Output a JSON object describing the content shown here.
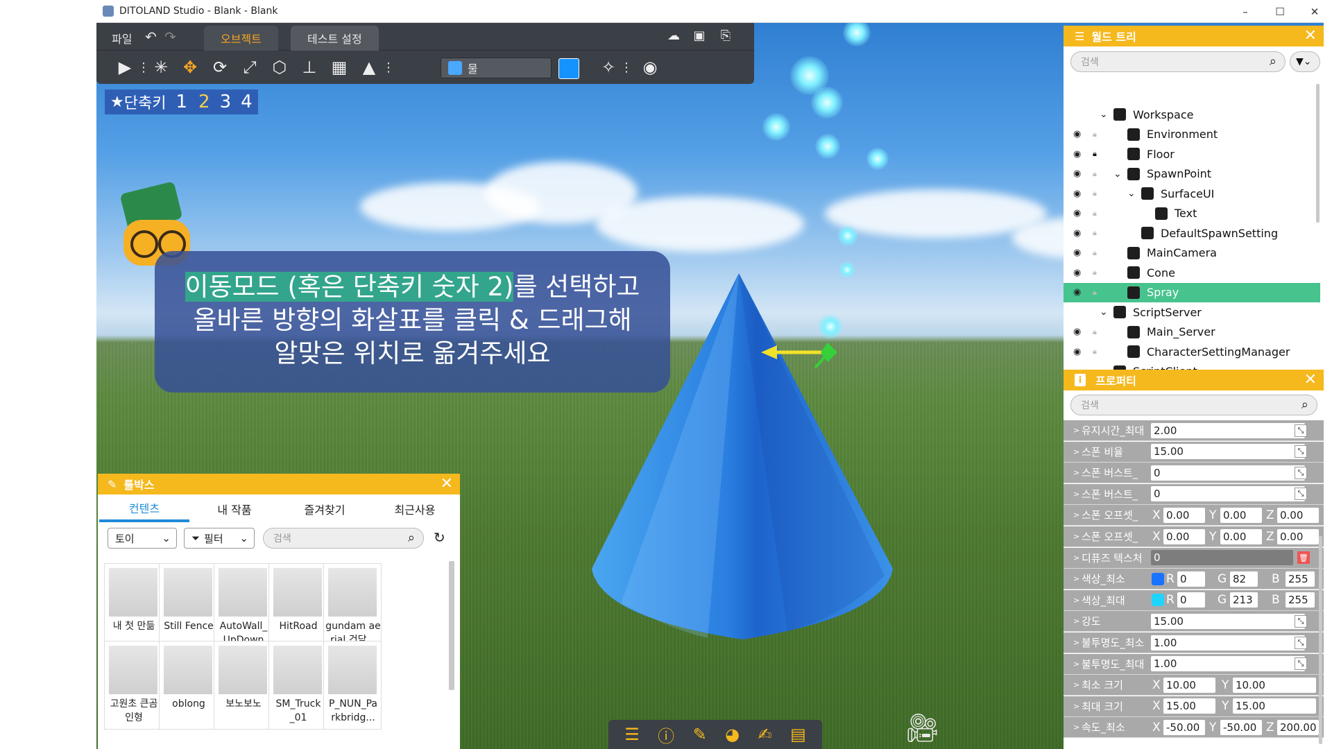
{
  "window": {
    "title": "DITOLAND Studio - Blank - Blank",
    "minimize": "–",
    "maximize": "☐",
    "close": "✕"
  },
  "menu": {
    "file": "파일",
    "undo_icon": "undo-icon",
    "redo_icon": "redo-icon"
  },
  "tabs": [
    {
      "label": "오브젝트",
      "active": true
    },
    {
      "label": "테스트 설정",
      "active": false
    }
  ],
  "toolbar": {
    "material_name": "물",
    "material_color": "#1493ff"
  },
  "shortcut": {
    "label": "단축키",
    "keys": [
      "1",
      "2",
      "3",
      "4"
    ]
  },
  "tooltip": {
    "line1_highlight": "이동모드 (혹은 단축키 숫자 2)",
    "line1_rest": "를 선택하고",
    "line2": "올바른 방향의 화살표를 클릭 & 드래그해",
    "line3": "알맞은 위치로 옮겨주세요"
  },
  "world_tree": {
    "title": "월드 트리",
    "search_placeholder": "검색",
    "items": [
      {
        "label": "Workspace",
        "icon": "workspace-icon"
      },
      {
        "label": "Environment",
        "icon": "environment-icon"
      },
      {
        "label": "Floor",
        "icon": "part-icon"
      },
      {
        "label": "SpawnPoint",
        "icon": "part-icon"
      },
      {
        "label": "SurfaceUI",
        "icon": "surfaceui-icon"
      },
      {
        "label": "Text",
        "icon": "text-icon"
      },
      {
        "label": "DefaultSpawnSetting",
        "icon": "script-icon"
      },
      {
        "label": "MainCamera",
        "icon": "camera-icon"
      },
      {
        "label": "Cone",
        "icon": "part-icon"
      },
      {
        "label": "Spray",
        "icon": "spray-icon",
        "selected": true
      },
      {
        "label": "ScriptServer",
        "icon": "script-icon"
      },
      {
        "label": "Main_Server",
        "icon": "script-icon"
      },
      {
        "label": "CharacterSettingManager",
        "icon": "script-icon"
      },
      {
        "label": "ScriptClient",
        "icon": "script-client-icon"
      }
    ]
  },
  "properties": {
    "title": "프로퍼티",
    "search_placeholder": "검색",
    "rows": [
      {
        "name": "유지시간_최대",
        "value": "2.00"
      },
      {
        "name": "스폰 비율",
        "value": "15.00"
      },
      {
        "name": "스폰 버스트_",
        "value": "0"
      },
      {
        "name": "스폰 버스트_",
        "value": "0"
      },
      {
        "name": "스폰 오프셋_",
        "x": "0.00",
        "y": "0.00",
        "z": "0.00"
      },
      {
        "name": "스폰 오프셋_",
        "x": "0.00",
        "y": "0.00",
        "z": "0.00"
      },
      {
        "name": "디퓨즈 텍스처",
        "value": "0"
      },
      {
        "name": "색상_최소",
        "r": "0",
        "g": "82",
        "b": "255",
        "swatch": "#1a73ff"
      },
      {
        "name": "색상_최대",
        "r": "0",
        "g": "213",
        "b": "255",
        "swatch": "#1fd5ff"
      },
      {
        "name": "강도",
        "value": "15.00"
      },
      {
        "name": "불투명도_최소",
        "value": "1.00"
      },
      {
        "name": "불투명도_최대",
        "value": "1.00"
      },
      {
        "name": "최소 크기",
        "x": "10.00",
        "y": "10.00"
      },
      {
        "name": "최대 크기",
        "x": "15.00",
        "y": "15.00"
      },
      {
        "name": "속도_최소",
        "x": "-50.00",
        "y": "-50.00",
        "z": "200.00"
      }
    ]
  },
  "toolbox": {
    "title": "툴박스",
    "tabs": [
      "컨텐츠",
      "내 작품",
      "즐겨찾기",
      "최근사용"
    ],
    "category": "토이",
    "filter": "필터",
    "search_placeholder": "검색",
    "items": [
      {
        "label": "내 첫 만듦"
      },
      {
        "label": "Still Fence"
      },
      {
        "label": "AutoWall_ UpDown"
      },
      {
        "label": "HitRoad"
      },
      {
        "label": "gundam ae rial 건담..."
      },
      {
        "label": "고원초 큰곰 인형"
      },
      {
        "label": "oblong"
      },
      {
        "label": "보노보노"
      },
      {
        "label": "SM_Truck _01"
      },
      {
        "label": "P_NUN_Pa rkbridg..."
      }
    ]
  },
  "dock_icons": [
    "list-icon",
    "info-icon",
    "wrench-icon",
    "palette-icon",
    "edit-icon",
    "clipboard-icon"
  ]
}
